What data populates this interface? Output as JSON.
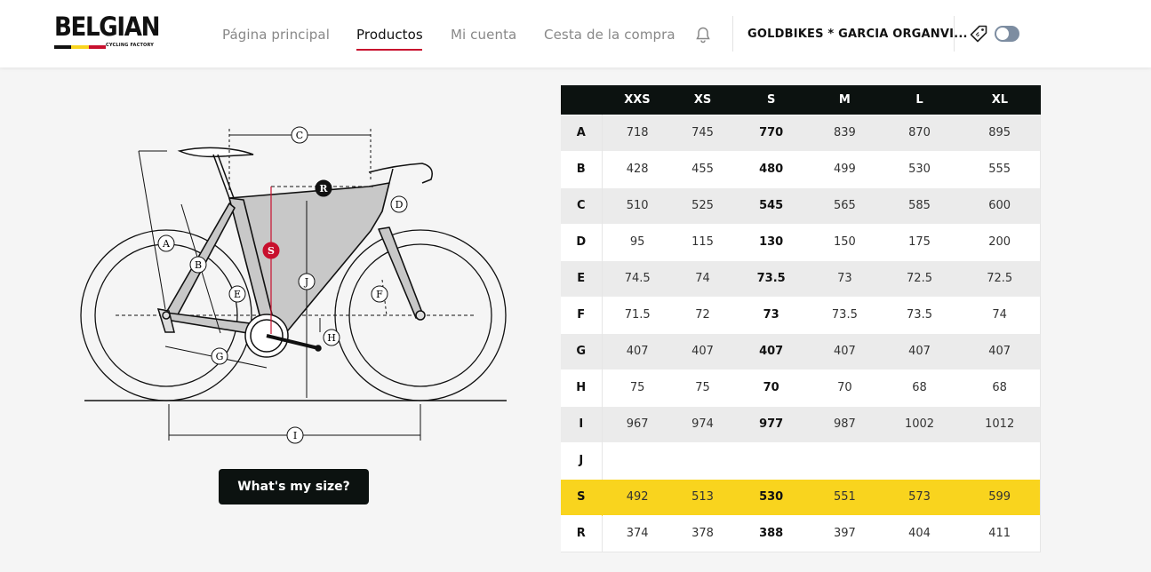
{
  "header": {
    "logo": {
      "word": "BELGIAN",
      "tagline": "CYCLING FACTORY",
      "flag_colors": [
        "#111111",
        "#f9d41e",
        "#c8102e"
      ]
    },
    "nav": [
      {
        "label": "Página principal",
        "active": false
      },
      {
        "label": "Productos",
        "active": true
      },
      {
        "label": "Mi cuenta",
        "active": false
      },
      {
        "label": "Cesta de la compra",
        "active": false
      }
    ],
    "account_name": "GOLDBIKES * GARCIA ORGANVI...",
    "accent_color": "#c8102e"
  },
  "diagram": {
    "labels": [
      "A",
      "B",
      "C",
      "D",
      "E",
      "F",
      "G",
      "H",
      "I",
      "J",
      "S",
      "R"
    ]
  },
  "size_button_label": "What's my size?",
  "geometry": {
    "sizes": [
      "XXS",
      "XS",
      "S",
      "M",
      "L",
      "XL"
    ],
    "rows": [
      {
        "label": "A",
        "values": [
          "718",
          "745",
          "770",
          "839",
          "870",
          "895"
        ]
      },
      {
        "label": "B",
        "values": [
          "428",
          "455",
          "480",
          "499",
          "530",
          "555"
        ]
      },
      {
        "label": "C",
        "values": [
          "510",
          "525",
          "545",
          "565",
          "585",
          "600"
        ]
      },
      {
        "label": "D",
        "values": [
          "95",
          "115",
          "130",
          "150",
          "175",
          "200"
        ]
      },
      {
        "label": "E",
        "values": [
          "74.5",
          "74",
          "73.5",
          "73",
          "72.5",
          "72.5"
        ]
      },
      {
        "label": "F",
        "values": [
          "71.5",
          "72",
          "73",
          "73.5",
          "73.5",
          "74"
        ]
      },
      {
        "label": "G",
        "values": [
          "407",
          "407",
          "407",
          "407",
          "407",
          "407"
        ]
      },
      {
        "label": "H",
        "values": [
          "75",
          "75",
          "70",
          "70",
          "68",
          "68"
        ]
      },
      {
        "label": "I",
        "values": [
          "967",
          "974",
          "977",
          "987",
          "1002",
          "1012"
        ]
      },
      {
        "label": "J",
        "values": [
          "",
          "",
          "",
          "",
          "",
          ""
        ]
      },
      {
        "label": "S",
        "values": [
          "492",
          "513",
          "530",
          "551",
          "573",
          "599"
        ],
        "highlight": true
      },
      {
        "label": "R",
        "values": [
          "374",
          "378",
          "388",
          "397",
          "404",
          "411"
        ]
      }
    ],
    "bold_size": "S",
    "highlight_color": "#f9d41e"
  }
}
